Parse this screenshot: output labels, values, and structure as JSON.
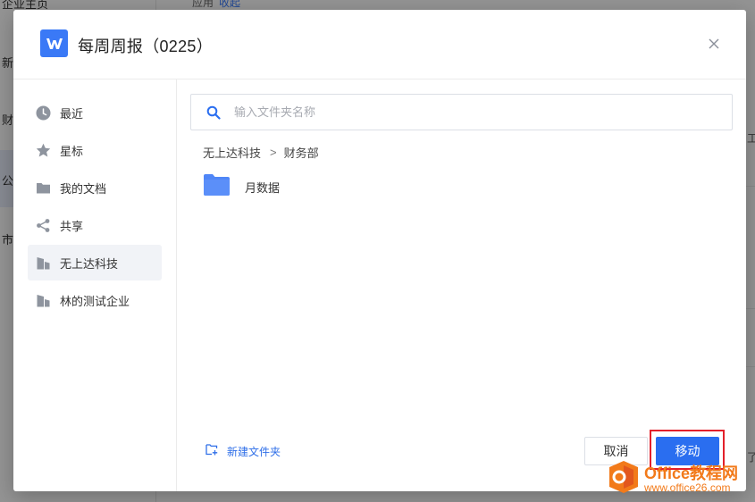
{
  "background": {
    "sidebar_items": [
      "企业主页",
      "新",
      "财",
      "公",
      "市"
    ],
    "top_strip": {
      "text": "应用",
      "link": "收起"
    },
    "right_fragments": [
      "工",
      "了"
    ]
  },
  "dialog": {
    "logo_letter": "W",
    "title": "每周周报（0225）",
    "close_icon": "close-icon"
  },
  "sidebar": {
    "items": [
      {
        "label": "最近",
        "icon": "clock-icon",
        "active": false
      },
      {
        "label": "星标",
        "icon": "star-icon",
        "active": false
      },
      {
        "label": "我的文档",
        "icon": "folder-icon",
        "active": false
      },
      {
        "label": "共享",
        "icon": "share-icon",
        "active": false
      },
      {
        "label": "无上达科技",
        "icon": "building-icon",
        "active": true
      },
      {
        "label": "林的测试企业",
        "icon": "building-icon",
        "active": false
      }
    ]
  },
  "search": {
    "placeholder": "输入文件夹名称",
    "value": ""
  },
  "breadcrumb": {
    "items": [
      "无上达科技",
      "财务部"
    ],
    "separator": ">"
  },
  "folders": [
    {
      "name": "月数据",
      "icon": "folder-icon"
    }
  ],
  "footer": {
    "new_folder_label": "新建文件夹",
    "cancel_label": "取消",
    "move_label": "移动"
  },
  "watermark": {
    "line1": "Office教程网",
    "line2": "www.office26.com"
  },
  "colors": {
    "accent": "#2a6ef0",
    "folder": "#4f86f7",
    "highlight_box": "#e3202a",
    "watermark": "#f27a1a"
  }
}
